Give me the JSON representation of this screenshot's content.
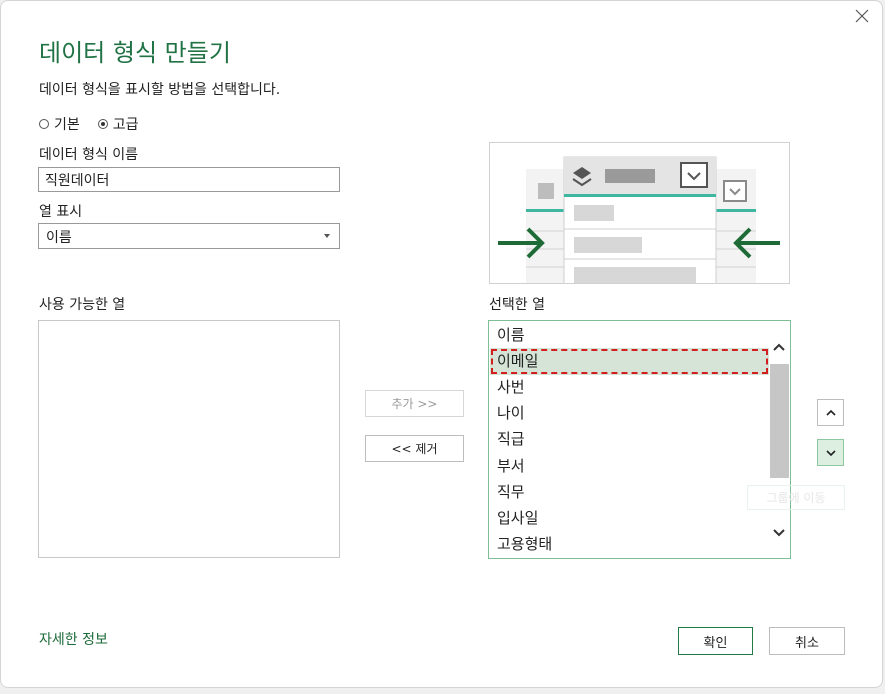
{
  "dialog": {
    "title": "데이터 형식 만들기",
    "subtitle": "데이터 형식을 표시할 방법을 선택합니다.",
    "close_icon": "close-icon"
  },
  "mode": {
    "options": [
      "기본",
      "고급"
    ],
    "selected": "고급"
  },
  "name_field": {
    "label": "데이터 형식 이름",
    "value": "직원데이터"
  },
  "display_column": {
    "label": "열 표시",
    "value": "이름"
  },
  "available": {
    "label": "사용 가능한 열",
    "items": []
  },
  "selected": {
    "label": "선택한 열",
    "items": [
      "이름",
      "이메일",
      "사번",
      "나이",
      "직급",
      "부서",
      "직무",
      "입사일",
      "고용형태"
    ],
    "highlighted": "이메일"
  },
  "buttons": {
    "add": "추가 >>",
    "remove": "<< 제거",
    "move_up_icon": "chevron-up-icon",
    "move_down_icon": "chevron-down-icon",
    "ghost": "그룹에 이동",
    "more_info": "자세한 정보",
    "ok": "확인",
    "cancel": "취소"
  },
  "colors": {
    "accent": "#217346",
    "selection_bg": "#d6e4d8",
    "highlight_border": "#d11f1f"
  }
}
